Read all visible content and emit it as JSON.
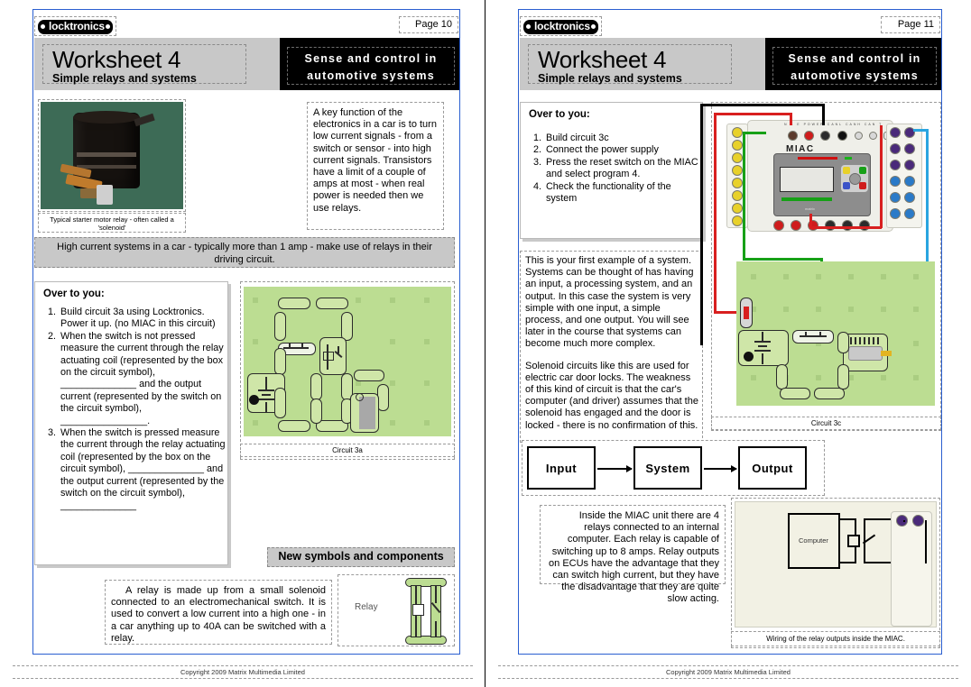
{
  "brand": {
    "logo_text": "locktronics"
  },
  "left_page": {
    "page_label": "Page 10",
    "worksheet_title": "Worksheet 4",
    "worksheet_subtitle": "Simple relays and systems",
    "topic_banner": "Sense and control in automotive systems",
    "photo_caption": "Typical starter motor relay - often called a 'solenoid'",
    "intro_text": "A key function of the electronics in a car is to turn low current signals - from a switch or sensor - into high current signals. Transistors have a limit of a couple of amps at most - when real power is needed then we use relays.",
    "grey_band": "High current systems in a car - typically more than 1 amp - make use of relays in their driving circuit.",
    "over_to_you_title": "Over to you:",
    "steps": [
      "Build circuit 3a using Locktronics. Power it up. (no MIAC in this circuit)",
      "When the switch is not pressed measure the current through the relay actuating coil (represented by the box on the circuit symbol), ______________ and the output current (represented by the switch on the circuit symbol), ________________.",
      "When the switch is pressed measure the current through the relay actuating coil (represented by the box on the circuit symbol), ______________ and the output current (represented by the switch on the circuit symbol), ______________"
    ],
    "circuit_caption": "Circuit 3a",
    "new_symbols_title": "New symbols and components",
    "relay_description": "A relay is made up from a small solenoid connected to an electromechanical switch. It is used to convert a low current into a high one - in a car anything up to 40A can be switched with a relay.",
    "relay_label": "Relay",
    "footer": "Copyright 2009 Matrix Multimedia Limited"
  },
  "right_page": {
    "page_label": "Page 11",
    "worksheet_title": "Worksheet 4",
    "worksheet_subtitle": "Simple relays and systems",
    "topic_banner": "Sense and control in automotive systems",
    "over_to_you_title": "Over to you:",
    "steps": [
      "Build circuit 3c",
      "Connect the power supply",
      "Press the reset switch on the MIAC and select program 4.",
      "Check the functionality of the system"
    ],
    "body_paragraph_1": "This is your first example of a system. Systems can be thought of has having an input, a processing system, and an output. In this case the system is very simple with one input, a simple process, and one output. You will see later in the course that systems can become much more complex.",
    "body_paragraph_2": "Solenoid circuits like this are used for electric car door locks. The weakness of this kind of circuit is that the car's computer (and driver) assumes that the solenoid has engaged and the door is locked - there is no confirmation of this.",
    "circuit_caption": "Circuit 3c",
    "flow": {
      "input": "Input",
      "system": "System",
      "output": "Output"
    },
    "miac_note": "Inside the MIAC unit there are 4 relays connected to an internal computer. Each relay is capable of switching up to 8 amps.  Relay outputs on ECUs have the advantage that they can switch high current, but they have the disadvantage that they are quite slow acting.",
    "wiring_caption": "Wiring of the relay outputs inside the MIAC.",
    "computer_label": "Computer",
    "miac_board_label": "MIAC",
    "footer": "Copyright 2009 Matrix Multimedia Limited"
  },
  "colors": {
    "banner_grey": "#c8c8c8",
    "banner_black": "#000000",
    "board_green": "#bcdd92",
    "brick_green": "#cfe6a8",
    "blue_rule": "#2a5fd0",
    "wire_red": "#d81f1f",
    "wire_green": "#17a017",
    "wire_blue": "#2aa5e0",
    "wire_black": "#000000"
  }
}
